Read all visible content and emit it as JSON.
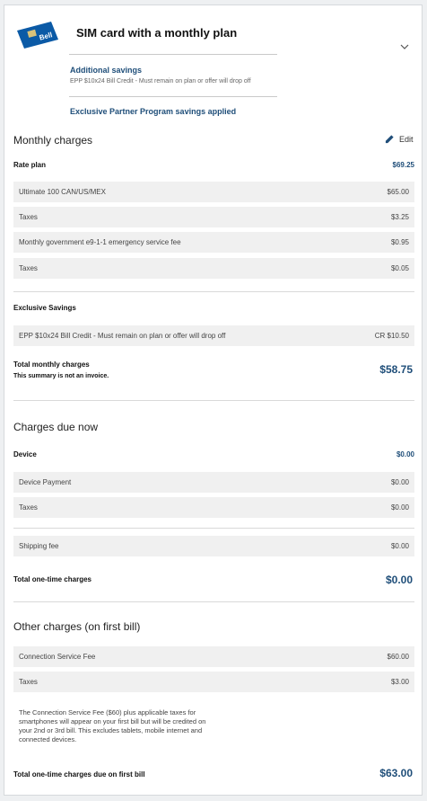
{
  "plan": {
    "title": "SIM card with a monthly plan",
    "sim_logo_text": "Bell",
    "additional_savings_label": "Additional savings",
    "additional_savings_detail": "EPP $10x24 Bill Credit - Must remain on plan or offer will drop off",
    "partner_applied": "Exclusive Partner Program savings applied"
  },
  "monthly": {
    "title": "Monthly charges",
    "edit_label": "Edit",
    "rate_plan_label": "Rate plan",
    "rate_plan_amount": "$69.25",
    "rows": [
      {
        "label": "Ultimate 100 CAN/US/MEX",
        "amount": "$65.00"
      },
      {
        "label": "Taxes",
        "amount": "$3.25"
      },
      {
        "label": "Monthly government e9-1-1 emergency service fee",
        "amount": "$0.95"
      },
      {
        "label": "Taxes",
        "amount": "$0.05"
      }
    ],
    "savings_label": "Exclusive Savings",
    "savings_rows": [
      {
        "label": "EPP $10x24 Bill Credit - Must remain on plan or offer will drop off",
        "amount": "CR $10.50"
      }
    ],
    "total_label": "Total monthly charges",
    "total_note": "This summary is not an invoice.",
    "total_amount": "$58.75"
  },
  "due_now": {
    "title": "Charges due now",
    "device_label": "Device",
    "device_amount": "$0.00",
    "rows": [
      {
        "label": "Device Payment",
        "amount": "$0.00"
      },
      {
        "label": "Taxes",
        "amount": "$0.00"
      }
    ],
    "shipping_label": "Shipping fee",
    "shipping_amount": "$0.00",
    "total_label": "Total one-time charges",
    "total_amount": "$0.00"
  },
  "other": {
    "title": "Other charges (on first bill)",
    "rows": [
      {
        "label": "Connection Service Fee",
        "amount": "$60.00"
      },
      {
        "label": "Taxes",
        "amount": "$3.00"
      }
    ],
    "note": "The Connection Service Fee ($60) plus applicable taxes for smartphones will appear on your first bill but will be credited on your 2nd or 3rd bill. This excludes tablets, mobile internet and connected devices.",
    "total_label": "Total one-time charges due on first bill",
    "total_amount": "$63.00"
  },
  "colors": {
    "accent": "#1f4e79",
    "sim_blue": "#0b5aa6"
  },
  "icons": {
    "edit": "pencil-icon",
    "expand": "chevron-down-icon"
  }
}
